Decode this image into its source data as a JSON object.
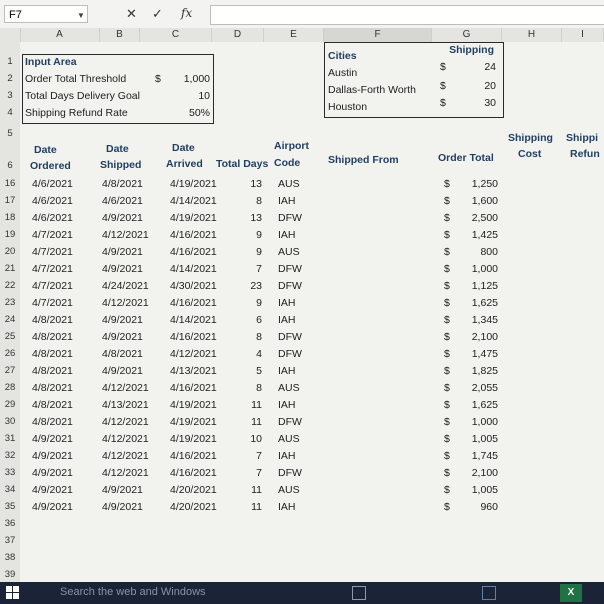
{
  "namebox": {
    "value": "F7"
  },
  "formula": {
    "fx_label": "fx",
    "cancel": "✕",
    "confirm": "✓"
  },
  "columns": [
    "A",
    "B",
    "C",
    "D",
    "E",
    "F",
    "G",
    "H",
    "I"
  ],
  "rows": [
    "1",
    "2",
    "3",
    "4",
    "5",
    "6",
    "16",
    "17",
    "18",
    "19",
    "20",
    "21",
    "22",
    "23",
    "24",
    "25",
    "26",
    "27",
    "28",
    "29",
    "30",
    "31",
    "32",
    "33",
    "34",
    "35",
    "36",
    "37",
    "38",
    "39"
  ],
  "input_area": {
    "title": "Input Area",
    "items": [
      {
        "label": "Order Total Threshold",
        "currency": "$",
        "value": "1,000"
      },
      {
        "label": "Total Days Delivery Goal",
        "currency": "",
        "value": "10"
      },
      {
        "label": "Shipping Refund Rate",
        "currency": "",
        "value": "50%"
      }
    ]
  },
  "cities": {
    "header_city": "Cities",
    "header_shipping": "Shipping",
    "items": [
      {
        "city": "Austin",
        "currency": "$",
        "value": "24"
      },
      {
        "city": "Dallas-Forth Worth",
        "currency": "$",
        "value": "20"
      },
      {
        "city": "Houston",
        "currency": "$",
        "value": "30"
      }
    ]
  },
  "table_headers": {
    "date_ordered": [
      "Date",
      "Ordered"
    ],
    "date_shipped": [
      "Date",
      "Shipped"
    ],
    "date_arrived": [
      "Date",
      "Arrived"
    ],
    "total_days": "Total Days",
    "airport_code": [
      "Airport",
      "Code"
    ],
    "shipped_from": "Shipped From",
    "order_total": "Order Total",
    "shipping_cost": [
      "Shipping",
      "Cost"
    ],
    "shipping_refund": [
      "Shippi",
      "Refun"
    ]
  },
  "orders": [
    {
      "ordered": "4/6/2021",
      "shipped": "4/8/2021",
      "arrived": "4/19/2021",
      "days": "13",
      "code": "AUS",
      "total": "1,250"
    },
    {
      "ordered": "4/6/2021",
      "shipped": "4/6/2021",
      "arrived": "4/14/2021",
      "days": "8",
      "code": "IAH",
      "total": "1,600"
    },
    {
      "ordered": "4/6/2021",
      "shipped": "4/9/2021",
      "arrived": "4/19/2021",
      "days": "13",
      "code": "DFW",
      "total": "2,500"
    },
    {
      "ordered": "4/7/2021",
      "shipped": "4/12/2021",
      "arrived": "4/16/2021",
      "days": "9",
      "code": "IAH",
      "total": "1,425"
    },
    {
      "ordered": "4/7/2021",
      "shipped": "4/9/2021",
      "arrived": "4/16/2021",
      "days": "9",
      "code": "AUS",
      "total": "800"
    },
    {
      "ordered": "4/7/2021",
      "shipped": "4/9/2021",
      "arrived": "4/14/2021",
      "days": "7",
      "code": "DFW",
      "total": "1,000"
    },
    {
      "ordered": "4/7/2021",
      "shipped": "4/24/2021",
      "arrived": "4/30/2021",
      "days": "23",
      "code": "DFW",
      "total": "1,125"
    },
    {
      "ordered": "4/7/2021",
      "shipped": "4/12/2021",
      "arrived": "4/16/2021",
      "days": "9",
      "code": "IAH",
      "total": "1,625"
    },
    {
      "ordered": "4/8/2021",
      "shipped": "4/9/2021",
      "arrived": "4/14/2021",
      "days": "6",
      "code": "IAH",
      "total": "1,345"
    },
    {
      "ordered": "4/8/2021",
      "shipped": "4/9/2021",
      "arrived": "4/16/2021",
      "days": "8",
      "code": "DFW",
      "total": "2,100"
    },
    {
      "ordered": "4/8/2021",
      "shipped": "4/8/2021",
      "arrived": "4/12/2021",
      "days": "4",
      "code": "DFW",
      "total": "1,475"
    },
    {
      "ordered": "4/8/2021",
      "shipped": "4/9/2021",
      "arrived": "4/13/2021",
      "days": "5",
      "code": "IAH",
      "total": "1,825"
    },
    {
      "ordered": "4/8/2021",
      "shipped": "4/12/2021",
      "arrived": "4/16/2021",
      "days": "8",
      "code": "AUS",
      "total": "2,055"
    },
    {
      "ordered": "4/8/2021",
      "shipped": "4/13/2021",
      "arrived": "4/19/2021",
      "days": "11",
      "code": "IAH",
      "total": "1,625"
    },
    {
      "ordered": "4/8/2021",
      "shipped": "4/12/2021",
      "arrived": "4/19/2021",
      "days": "11",
      "code": "DFW",
      "total": "1,000"
    },
    {
      "ordered": "4/9/2021",
      "shipped": "4/12/2021",
      "arrived": "4/19/2021",
      "days": "10",
      "code": "AUS",
      "total": "1,005"
    },
    {
      "ordered": "4/9/2021",
      "shipped": "4/12/2021",
      "arrived": "4/16/2021",
      "days": "7",
      "code": "IAH",
      "total": "1,745"
    },
    {
      "ordered": "4/9/2021",
      "shipped": "4/12/2021",
      "arrived": "4/16/2021",
      "days": "7",
      "code": "DFW",
      "total": "2,100"
    },
    {
      "ordered": "4/9/2021",
      "shipped": "4/9/2021",
      "arrived": "4/20/2021",
      "days": "11",
      "code": "AUS",
      "total": "1,005"
    },
    {
      "ordered": "4/9/2021",
      "shipped": "4/9/2021",
      "arrived": "4/20/2021",
      "days": "11",
      "code": "IAH",
      "total": "960"
    }
  ],
  "currency_symbol": "$",
  "taskbar": {
    "search_text": "Search the web and Windows"
  },
  "icons": [
    "windows-start-icon",
    "task-view-icon",
    "store-icon",
    "excel-icon"
  ]
}
